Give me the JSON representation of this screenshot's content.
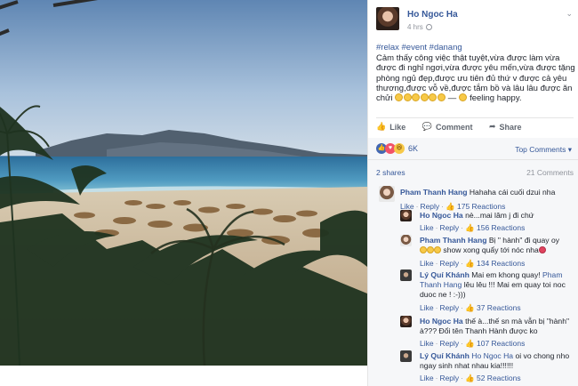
{
  "post": {
    "author": "Ho Ngoc Ha",
    "time": "4 hrs",
    "hashtags": "#relax #event #danang",
    "caption": "Cảm thấy công việc thật tuyệt,vừa được làm vừa được đi nghỉ ngơi,vừa được yêu mến,vừa được tặng phòng ngủ đẹp,được ưu tiên đủ thứ v được cả yêu thương,được vỗ về,được tắm bồ và lâu lâu được ăn chửi",
    "feeling_prefix": "—",
    "feeling": "feeling happy."
  },
  "actions": {
    "like": "Like",
    "comment": "Comment",
    "share": "Share"
  },
  "reactions": {
    "count": "6K",
    "top_comments": "Top Comments ▾"
  },
  "stats": {
    "shares": "2 shares",
    "comments": "21 Comments"
  },
  "comments": [
    {
      "name": "Pham Thanh Hang",
      "text": "Hahaha cái cuối dzui nha",
      "reply": "Reply",
      "reactions": "175 Reactions",
      "like": "Like"
    },
    {
      "name": "Ho Ngoc Ha",
      "text": "nè...mai lâm j đi chứ",
      "reply": "Reply",
      "reactions": "156 Reactions",
      "like": "Like"
    },
    {
      "name": "Pham Thanh Hang",
      "text_a": "Bị \" hành\" đi quay oy",
      "text_b": "show xong quẩy tới nóc nha",
      "reply": "Reply",
      "reactions": "134 Reactions",
      "like": "Like"
    },
    {
      "name": "Lý Quí Khánh",
      "text_a": "Mai em khong quay!",
      "tag": "Pham Thanh Hang",
      "text_b": "lêu lêu !!! Mai em quay toi noc duoc ne ! :-)))",
      "reply": "Reply",
      "reactions": "37 Reactions",
      "like": "Like"
    },
    {
      "name": "Ho Ngoc Ha",
      "text": "thế à...thế sn mà vẫn bị \"hành\" à??? Đổi tên Thanh Hành được ko",
      "reply": "Reply",
      "reactions": "107 Reactions",
      "like": "Like"
    },
    {
      "name": "Lý Quí Khánh",
      "tag": "Ho Ngoc Ha",
      "text": "oi vo chong nho ngay sinh nhat nhau kia!!!!!!",
      "reply": "Reply",
      "reactions": "52 Reactions",
      "like": "Like"
    }
  ],
  "icons": {
    "like": "thumbs-up-icon",
    "comment": "speech-bubble-icon",
    "share": "share-arrow-icon",
    "globe": "globe-icon",
    "menu": "chevron-down-icon"
  }
}
